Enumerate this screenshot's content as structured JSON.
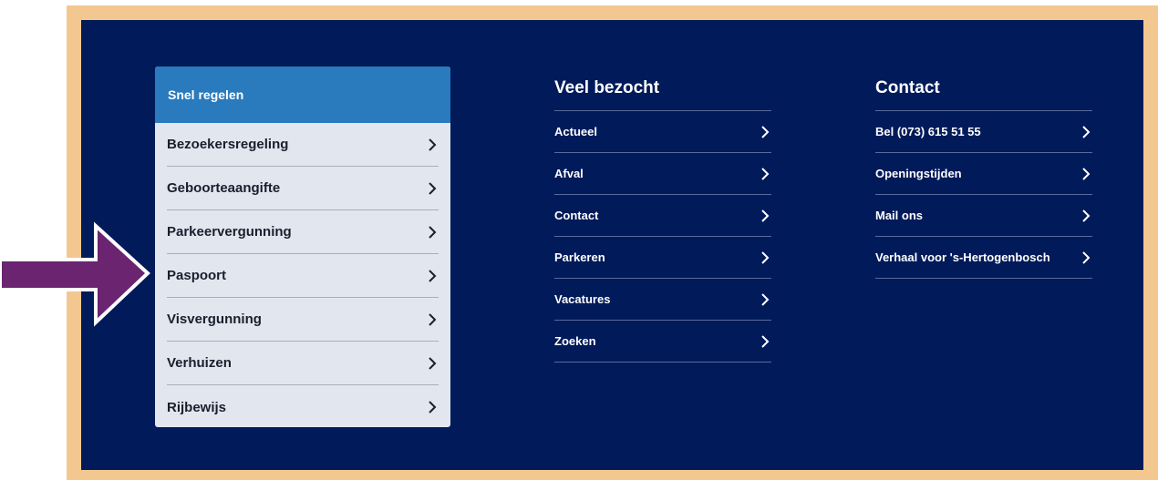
{
  "quick": {
    "title": "Snel regelen",
    "items": [
      {
        "label": "Bezoekersregeling"
      },
      {
        "label": "Geboorteaangifte"
      },
      {
        "label": "Parkeervergunning"
      },
      {
        "label": "Paspoort"
      },
      {
        "label": "Visvergunning"
      },
      {
        "label": "Verhuizen"
      },
      {
        "label": "Rijbewijs"
      }
    ]
  },
  "veel": {
    "title": "Veel bezocht",
    "items": [
      {
        "label": "Actueel"
      },
      {
        "label": "Afval"
      },
      {
        "label": "Contact"
      },
      {
        "label": "Parkeren"
      },
      {
        "label": "Vacatures"
      },
      {
        "label": "Zoeken"
      }
    ]
  },
  "contact": {
    "title": "Contact",
    "items": [
      {
        "label": "Bel (073) 615 51 55"
      },
      {
        "label": "Openingstijden"
      },
      {
        "label": "Mail ons"
      },
      {
        "label": "Verhaal voor 's-Hertogenbosch"
      }
    ]
  },
  "colors": {
    "frame": "#f3c890",
    "panel": "#001a5a",
    "quick_header": "#2a7bbd",
    "quick_body": "#e2e6ee",
    "arrow": "#6b2470"
  },
  "icons": {
    "chevron": "chevron-right-icon",
    "pointer": "arrow-right-icon"
  }
}
